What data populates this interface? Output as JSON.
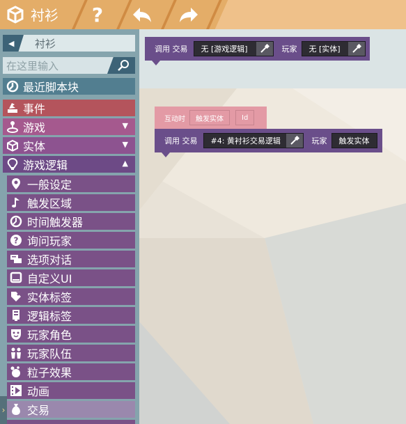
{
  "topbar": {
    "title": "衬衫",
    "icons": [
      "cube-icon",
      "help-icon",
      "undo-icon",
      "redo-icon"
    ]
  },
  "sidebar": {
    "breadcrumb": "衬衫",
    "search_placeholder": "在这里输入",
    "categories": [
      {
        "label": "最近脚本块",
        "icon": "recent-icon",
        "color": "#527e90"
      },
      {
        "label": "事件",
        "icon": "event-icon",
        "color": "#b4545c"
      },
      {
        "label": "游戏",
        "icon": "joystick-icon",
        "color": "#a5598e"
      },
      {
        "label": "实体",
        "icon": "cube-icon",
        "color": "#8d5390"
      },
      {
        "label": "游戏逻辑",
        "icon": "lightbulb-icon",
        "color": "#6d4a86"
      }
    ],
    "subitems": [
      {
        "label": "一般设定",
        "icon": "location-icon"
      },
      {
        "label": "触发区域",
        "icon": "music-note-icon"
      },
      {
        "label": "时间触发器",
        "icon": "clock-icon"
      },
      {
        "label": "询问玩家",
        "icon": "question-icon"
      },
      {
        "label": "选项对话",
        "icon": "chat-icon"
      },
      {
        "label": "自定义UI",
        "icon": "monitor-icon"
      },
      {
        "label": "实体标签",
        "icon": "tag-icon"
      },
      {
        "label": "逻辑标签",
        "icon": "memory-icon"
      },
      {
        "label": "玩家角色",
        "icon": "mask-icon"
      },
      {
        "label": "玩家队伍",
        "icon": "team-icon"
      },
      {
        "label": "粒子效果",
        "icon": "particles-icon"
      },
      {
        "label": "动画",
        "icon": "film-icon"
      },
      {
        "label": "交易",
        "icon": "moneybag-icon",
        "selected": true
      }
    ]
  },
  "canvas": {
    "block1": {
      "label": "调用 交易",
      "slot1": "无 [游戏逻辑]",
      "player_label": "玩家",
      "slot2": "无 [实体]"
    },
    "event_block": {
      "label": "互动时",
      "slot": "触发实体",
      "id": "Id"
    },
    "block2": {
      "label": "调用 交易",
      "slot1": "#4: 黄衬衫交易逻辑",
      "player_label": "玩家",
      "slot2": "触发实体"
    }
  },
  "colors": {
    "topbar": "#e4ad68",
    "sidebar": "#85a4ad",
    "logic_block": "#6a4e8a",
    "event_block": "#e39aa5"
  }
}
